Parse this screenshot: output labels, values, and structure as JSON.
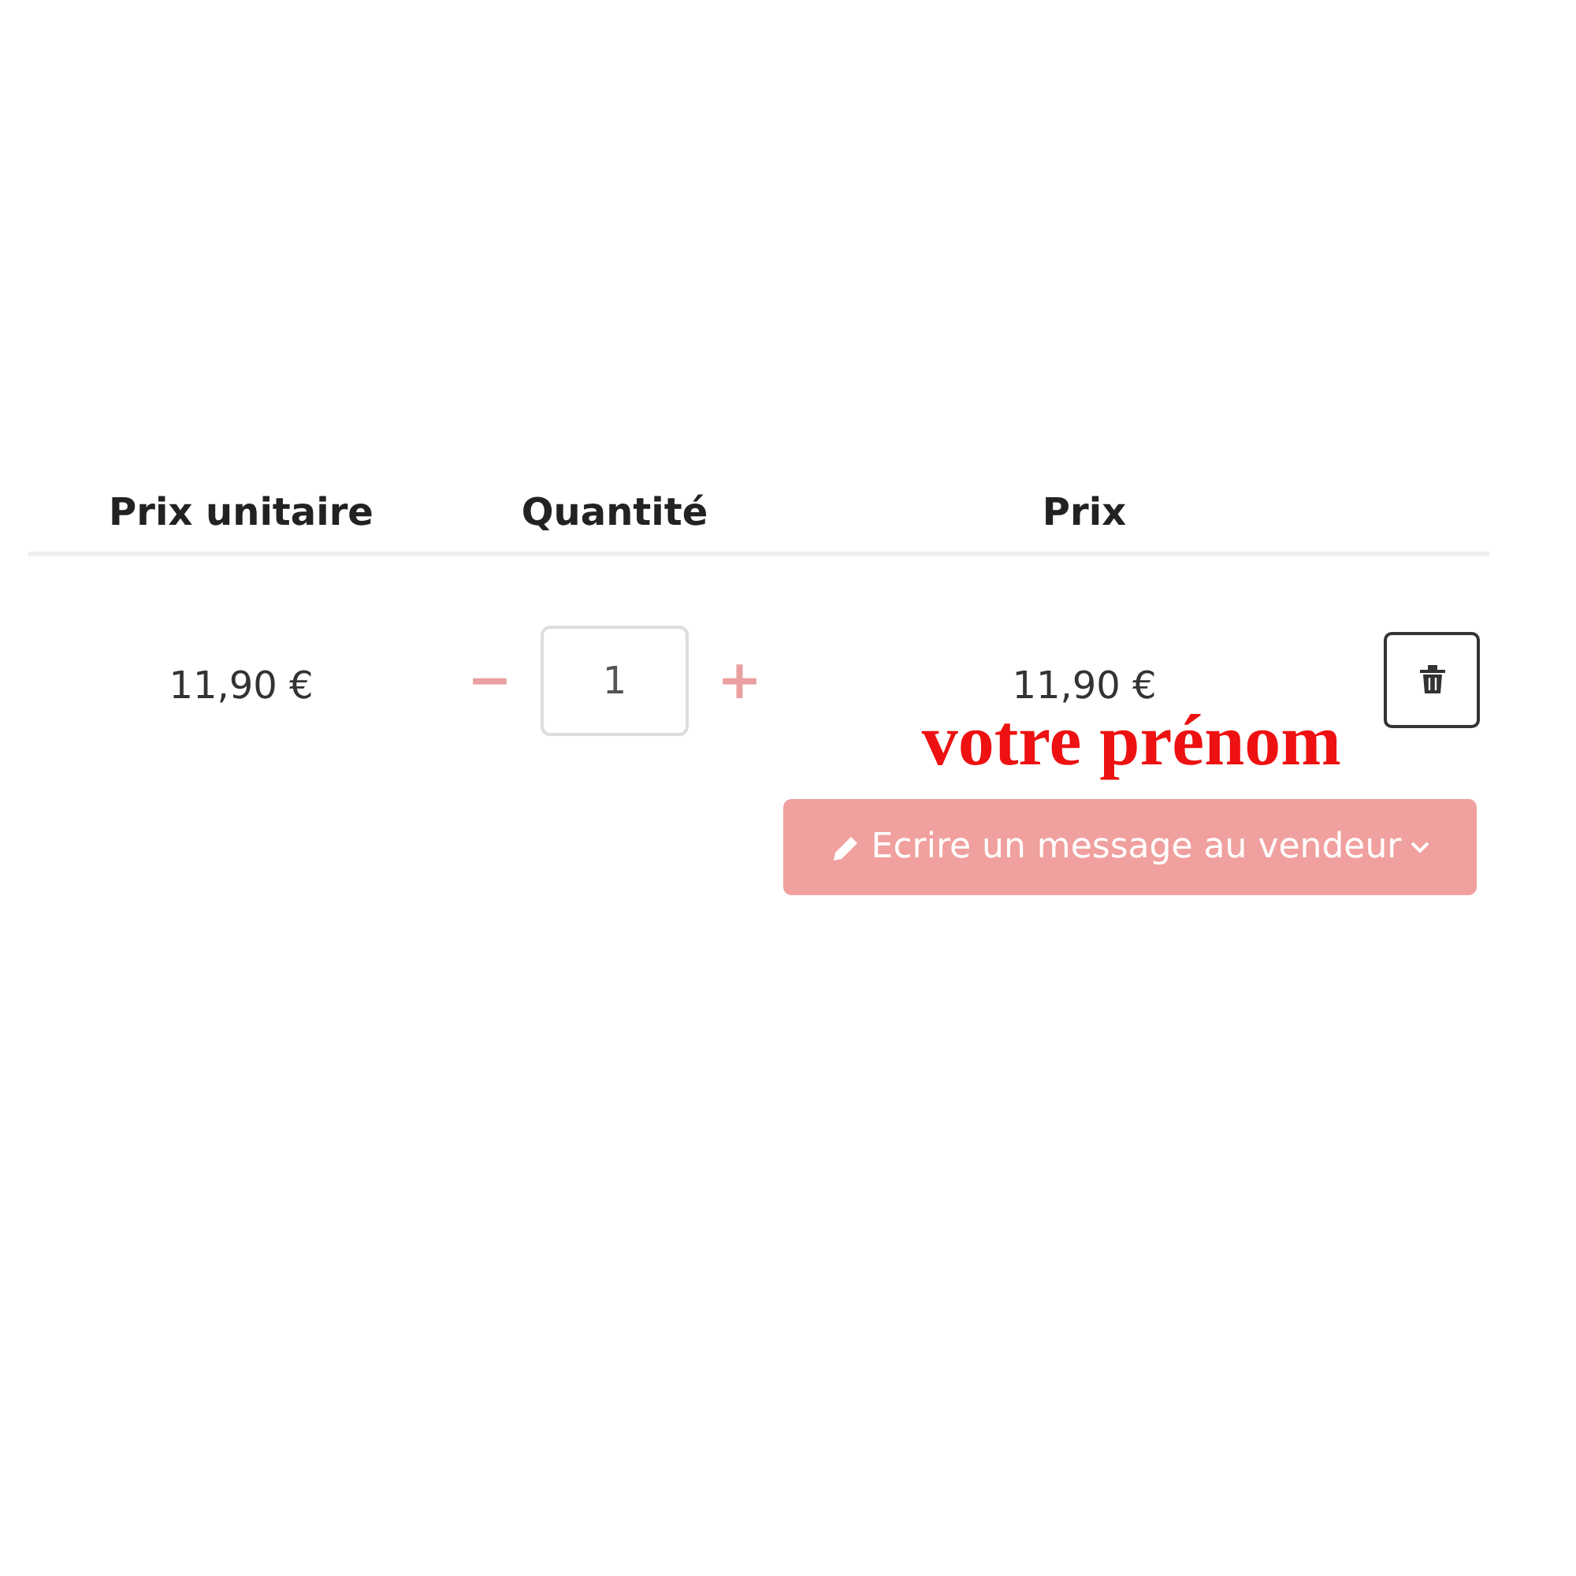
{
  "table": {
    "columns": [
      "Prix unitaire",
      "Quantité",
      "Prix"
    ],
    "rows": [
      {
        "unit_price": "11,90 €",
        "quantity": {
          "decrement": "−",
          "value": "1",
          "increment": "+"
        },
        "price": "11,90 €"
      }
    ]
  },
  "annotation": "votre prénom",
  "message_button": {
    "label": "Ecrire un message au vendeur",
    "expanded": false
  }
}
